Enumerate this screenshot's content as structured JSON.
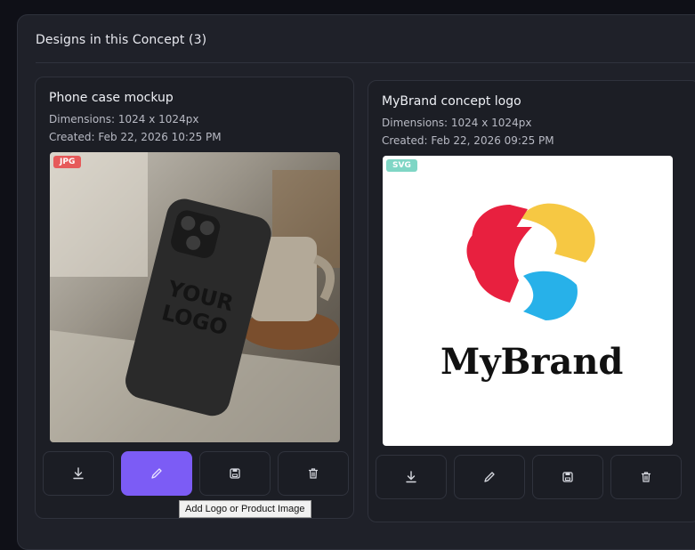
{
  "panel": {
    "title": "Designs in this Concept (3)"
  },
  "designs": [
    {
      "title": "Phone case mockup",
      "dimensions": "Dimensions: 1024 x 1024px",
      "created": "Created: Feb 22, 2026 10:25 PM",
      "format": "JPG",
      "mockup_text_1": "YOUR",
      "mockup_text_2": "LOGO"
    },
    {
      "title": "MyBrand concept logo",
      "dimensions": "Dimensions: 1024 x 1024px",
      "created": "Created: Feb 22, 2026 09:25 PM",
      "format": "SVG",
      "logo_text": "MyBrand"
    }
  ],
  "actions": [
    "download-icon",
    "pencil-icon",
    "save-icon",
    "trash-icon"
  ],
  "tooltip": "Add Logo or Product Image",
  "colors": {
    "accent": "#7c5cf5",
    "jpg_badge": "#e65a5a",
    "svg_badge": "#7fd6c5",
    "logo_red": "#e8203f",
    "logo_yellow": "#f6c843",
    "logo_blue": "#27b1e9"
  }
}
